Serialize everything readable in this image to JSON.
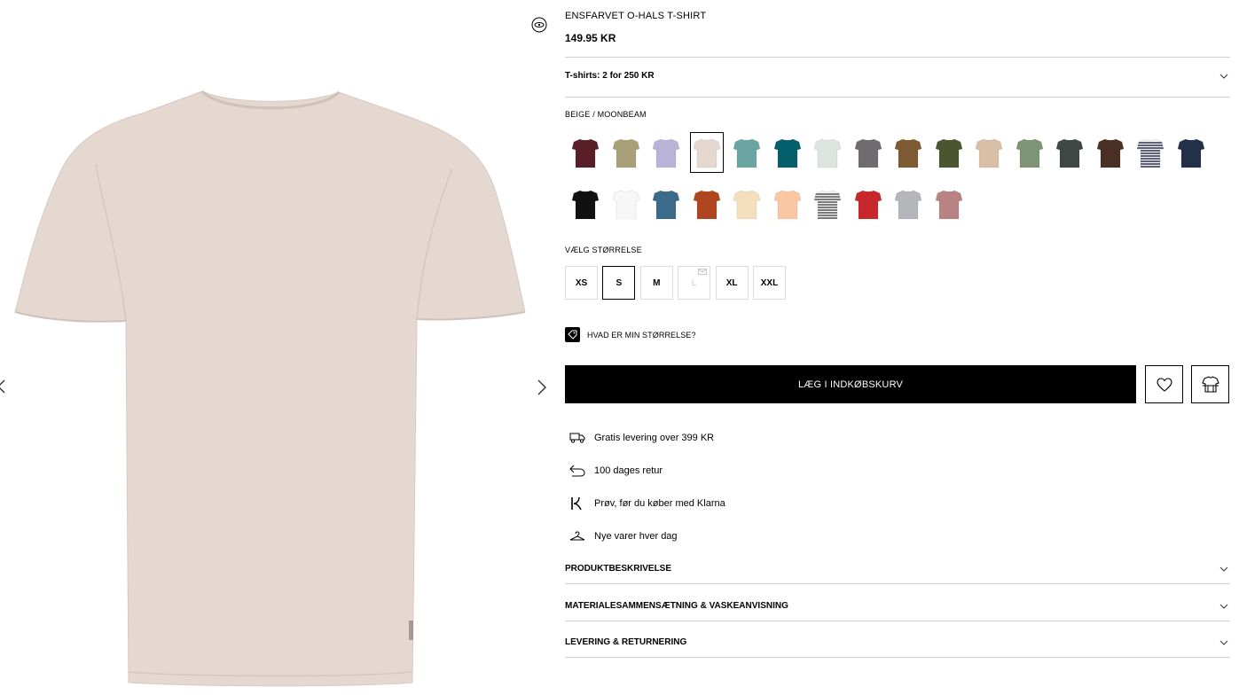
{
  "product": {
    "title": "ENSFARVET O-HALS T-SHIRT",
    "price": "149.95 KR",
    "promo": "T-shirts: 2 for 250 KR",
    "color_name": "BEIGE / MOONBEAM",
    "shirt_color": "#e4d8d0"
  },
  "gallery": {
    "prev_icon": "chevron-left-icon",
    "next_icon": "chevron-right-icon",
    "view_icon": "360-view-icon"
  },
  "swatches": [
    {
      "color": "#5a1e28",
      "selected": false
    },
    {
      "color": "#a9a07a",
      "selected": false
    },
    {
      "color": "#b9b3d8",
      "selected": false
    },
    {
      "color": "#e4d8d0",
      "selected": true
    },
    {
      "color": "#6aa5a3",
      "selected": false
    },
    {
      "color": "#045e6b",
      "selected": false
    },
    {
      "color": "#dde3df",
      "selected": false
    },
    {
      "color": "#6f6b6e",
      "selected": false
    },
    {
      "color": "#7d5a32",
      "selected": false
    },
    {
      "color": "#4b5530",
      "selected": false
    },
    {
      "color": "#d9bfa5",
      "selected": false
    },
    {
      "color": "#7d9475",
      "selected": false
    },
    {
      "color": "#3f4744",
      "selected": false
    },
    {
      "color": "#4a3024",
      "selected": false
    },
    {
      "color": "stripe-navy",
      "selected": false
    },
    {
      "color": "#24304a",
      "selected": false
    },
    {
      "color": "#111111",
      "selected": false
    },
    {
      "color": "#f7f7f7",
      "selected": false
    },
    {
      "color": "#3c6a8a",
      "selected": false
    },
    {
      "color": "#b0461f",
      "selected": false
    },
    {
      "color": "#f4dfbd",
      "selected": false
    },
    {
      "color": "#fbc6a2",
      "selected": false
    },
    {
      "color": "stripe-grey",
      "selected": false
    },
    {
      "color": "#c7282b",
      "selected": false
    },
    {
      "color": "#b4b6bb",
      "selected": false
    },
    {
      "color": "#b98283",
      "selected": false
    }
  ],
  "sizes": {
    "label": "VÆLG STØRRELSE",
    "options": [
      {
        "label": "XS",
        "state": "available"
      },
      {
        "label": "S",
        "state": "selected"
      },
      {
        "label": "M",
        "state": "available"
      },
      {
        "label": "L",
        "state": "unavailable"
      },
      {
        "label": "XL",
        "state": "available"
      },
      {
        "label": "XXL",
        "state": "available"
      }
    ],
    "guide": "HVAD ER MIN STØRRELSE?"
  },
  "actions": {
    "add_to_cart": "LÆG I INDKØBSKURV",
    "wishlist_icon": "heart-icon",
    "store_icon": "store-icon"
  },
  "usps": [
    {
      "icon": "truck-icon",
      "text": "Gratis levering over 399 KR"
    },
    {
      "icon": "return-arrow-icon",
      "text": "100 dages retur"
    },
    {
      "icon": "klarna-icon",
      "text": "Prøv, før du køber med Klarna"
    },
    {
      "icon": "hanger-icon",
      "text": "Nye varer hver dag"
    }
  ],
  "accordions": [
    {
      "label": "PRODUKTBESKRIVELSE"
    },
    {
      "label": "MATERIALESAMMENSÆTNING & VASKEANVISNING"
    },
    {
      "label": "LEVERING & RETURNERING"
    }
  ]
}
